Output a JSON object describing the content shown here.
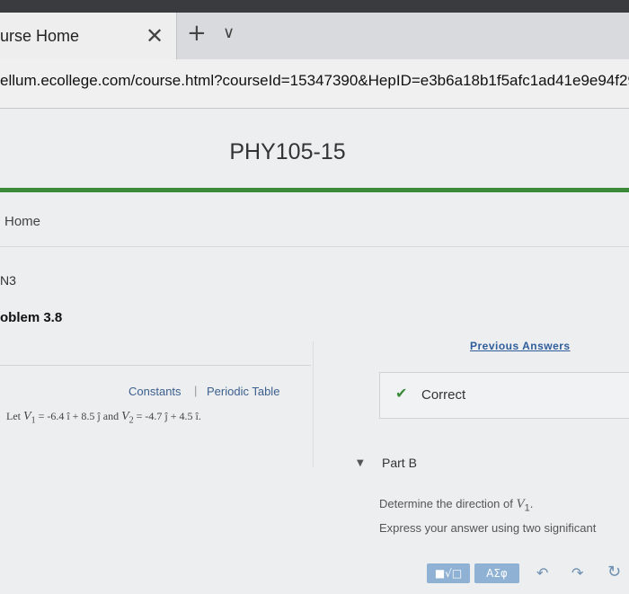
{
  "browser": {
    "tab_title": "urse Home",
    "tab_close_glyph": "✕",
    "new_tab_glyph": "+",
    "tab_menu_glyph": "∨",
    "url": "ellum.ecollege.com/course.html?courseId=15347390&HepID=e3b6a18b1f5afc1ad41e9e94f29"
  },
  "course": {
    "title": "PHY105-15",
    "home_label": "Home",
    "code": "N3",
    "problem": "oblem 3.8"
  },
  "assignment": {
    "previous_answers": "Previous Answers",
    "constants": "Constants",
    "separator": "|",
    "periodic_table": "Periodic Table",
    "formula": {
      "let": "Let",
      "v1": "V",
      "v1_sub": "1",
      "v1_expr": " = -6.4 î + 8.5 ĵ and ",
      "v2": "V",
      "v2_sub": "2",
      "v2_expr": " = -4.7 ĵ + 4.5 î."
    },
    "status_icon": "check-icon",
    "status": "Correct",
    "part": "Part B",
    "prompt": "Determine the direction of",
    "prompt_var": "V",
    "prompt_sub": "1",
    "prompt_end": ".",
    "instructions": "Express your answer using two significant"
  },
  "toolbar": {
    "templates_label": "■√□",
    "symbols_label": "ΑΣφ",
    "undo_glyph": "↶",
    "redo_glyph": "↷",
    "reset_glyph": "↻"
  },
  "colors": {
    "accent_green": "#3b8a3a",
    "link_blue": "#2f5d9c",
    "button_blue": "#8fb1d4"
  }
}
